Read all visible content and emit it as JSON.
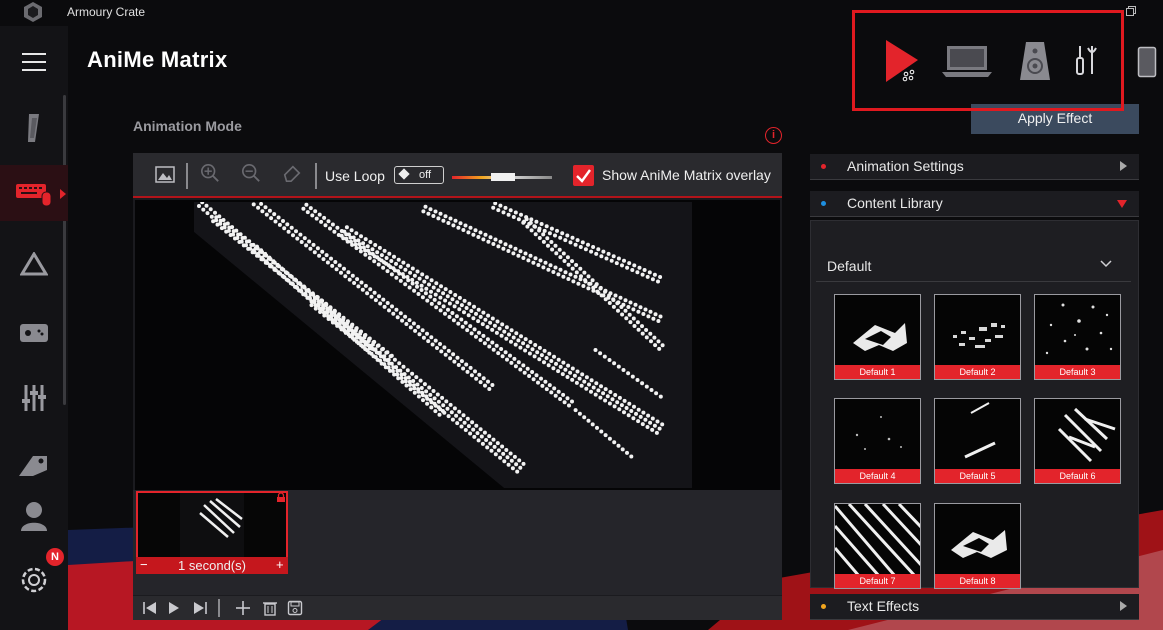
{
  "app": {
    "title": "Armoury Crate"
  },
  "page": {
    "title": "AniMe Matrix",
    "section_label": "Animation Mode",
    "info_icon": "i"
  },
  "header": {
    "apply_label": "Apply Effect",
    "devices": [
      "play-effect-icon",
      "laptop-icon",
      "speaker-icon",
      "tools-icon",
      "phone-icon"
    ]
  },
  "sidebar": {
    "items": [
      {
        "name": "menu-icon"
      },
      {
        "name": "rog-logo-icon"
      },
      {
        "name": "device-keyboard-icon",
        "active": true
      },
      {
        "name": "aura-icon"
      },
      {
        "name": "game-library-icon"
      },
      {
        "name": "scenario-profiles-icon"
      },
      {
        "name": "deals-icon"
      },
      {
        "name": "user-center-icon"
      },
      {
        "name": "settings-icon",
        "badge": "N"
      }
    ]
  },
  "editor": {
    "use_loop_label": "Use Loop",
    "loop_toggle_label": "off",
    "loop_speed": 0.4,
    "overlay_label": "Show AniMe Matrix overlay",
    "overlay_checked": true,
    "frame": {
      "duration_label": "1 second(s)",
      "minus": "−",
      "plus": "+"
    }
  },
  "right_panel": {
    "animation_settings_label": "Animation Settings",
    "content_library_label": "Content Library",
    "text_effects_label": "Text Effects",
    "library_select": "Default",
    "thumbnails": [
      "Default 1",
      "Default 2",
      "Default 3",
      "Default 4",
      "Default 5",
      "Default 6",
      "Default 7",
      "Default 8"
    ]
  },
  "colors": {
    "accent": "#e3242b",
    "background": "#0b0b0d",
    "panel": "#1c1c20",
    "apply_button": "#3b4a5e"
  }
}
